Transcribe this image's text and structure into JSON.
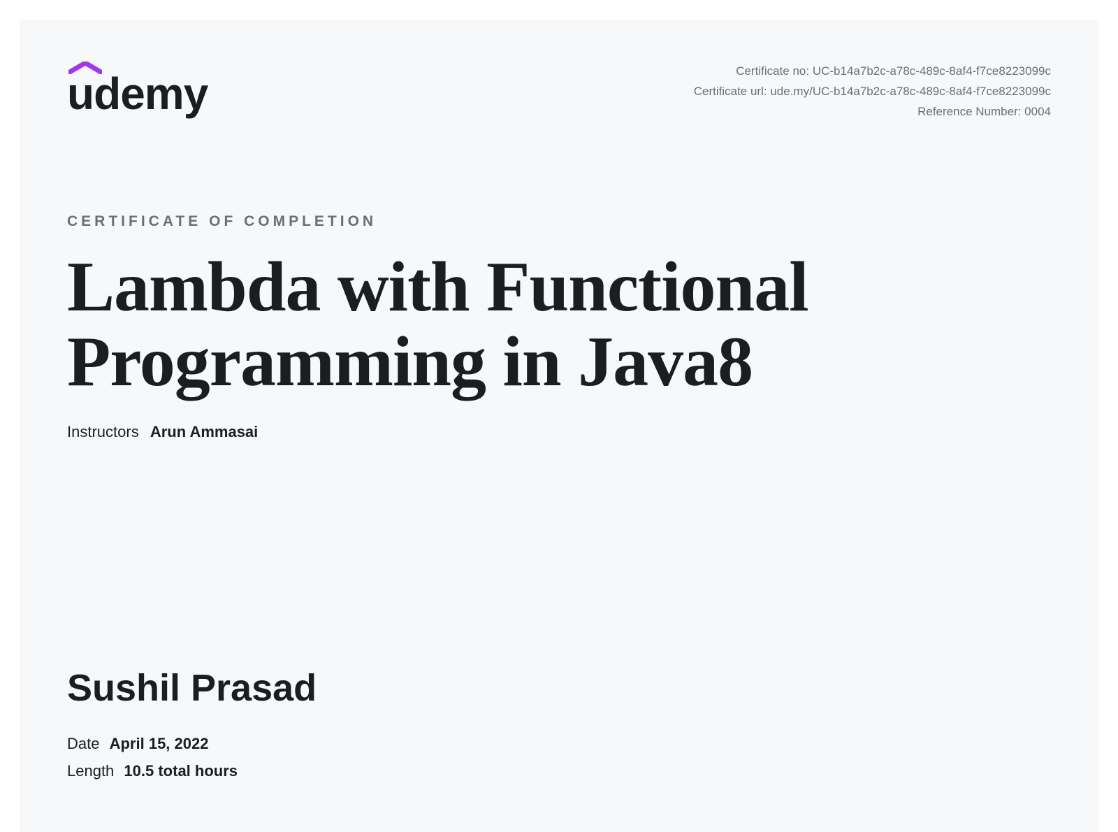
{
  "logo": {
    "text": "udemy",
    "caret_color": "#a435f0"
  },
  "meta": {
    "cert_no_label": "Certificate no:",
    "cert_no_value": "UC-b14a7b2c-a78c-489c-8af4-f7ce8223099c",
    "cert_url_label": "Certificate url:",
    "cert_url_value": "ude.my/UC-b14a7b2c-a78c-489c-8af4-f7ce8223099c",
    "ref_no_label": "Reference Number:",
    "ref_no_value": "0004"
  },
  "completion_label": "CERTIFICATE OF COMPLETION",
  "course_title": "Lambda with Functional Programming in Java8",
  "instructors": {
    "label": "Instructors",
    "name": "Arun Ammasai"
  },
  "recipient": {
    "name": "Sushil Prasad"
  },
  "details": {
    "date_label": "Date",
    "date_value": "April 15, 2022",
    "length_label": "Length",
    "length_value": "10.5 total hours"
  }
}
